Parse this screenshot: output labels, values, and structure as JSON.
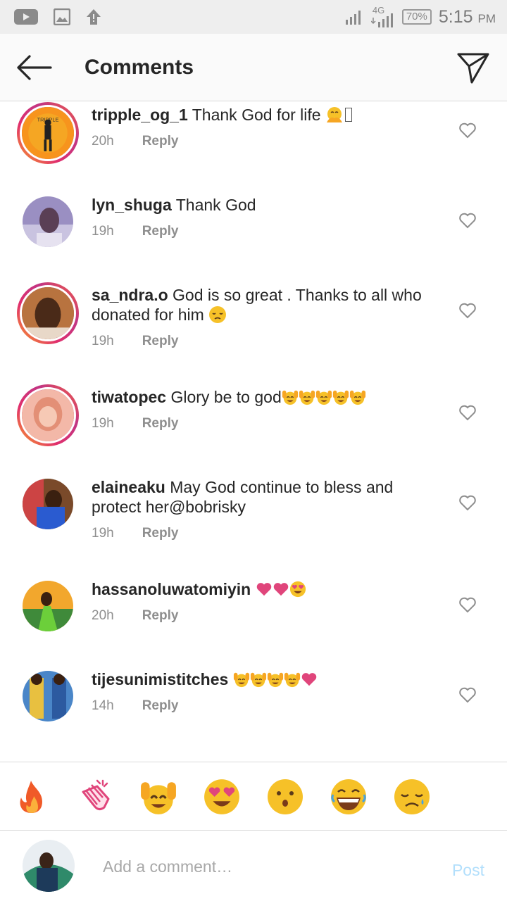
{
  "status_bar": {
    "network": "4G",
    "battery": "70%",
    "time": "5:15",
    "ampm": "PM"
  },
  "header": {
    "title": "Comments"
  },
  "comments": [
    {
      "user": "tripple_og_1",
      "text": "Thank God for life",
      "emojis": [
        "pray"
      ],
      "time": "20h",
      "reply": "Reply",
      "story_ring": true
    },
    {
      "user": "lyn_shuga",
      "text": "Thank God",
      "emojis": [],
      "time": "19h",
      "reply": "Reply",
      "story_ring": false
    },
    {
      "user": "sa_ndra.o",
      "text": "God is so great . Thanks to all who",
      "text_line2": "donated for him",
      "emojis": [
        "sad"
      ],
      "time": "19h",
      "reply": "Reply",
      "story_ring": true
    },
    {
      "user": "tiwatopec",
      "text": "Glory be to god",
      "emojis": [
        "raised-hands",
        "raised-hands",
        "raised-hands",
        "raised-hands",
        "raised-hands"
      ],
      "time": "19h",
      "reply": "Reply",
      "story_ring": true
    },
    {
      "user": "elaineaku",
      "text": "May God continue to bless and",
      "text_line2": "protect her@bobrisky",
      "emojis": [],
      "time": "19h",
      "reply": "Reply",
      "story_ring": false
    },
    {
      "user": "hassanoluwatomiyin",
      "text": "",
      "emojis": [
        "heart",
        "heart",
        "heart-eyes"
      ],
      "time": "20h",
      "reply": "Reply",
      "story_ring": false
    },
    {
      "user": "tijesunimistitches",
      "text": "",
      "emojis": [
        "raised-hands",
        "raised-hands",
        "raised-hands",
        "raised-hands",
        "heart"
      ],
      "time": "14h",
      "reply": "Reply",
      "story_ring": false
    }
  ],
  "emoji_bar": [
    "fire-icon",
    "clapping-hands-icon",
    "raised-hands-icon",
    "heart-eyes-icon",
    "surprised-icon",
    "laughing-icon",
    "sad-icon"
  ],
  "add_comment": {
    "placeholder": "Add a comment…",
    "post_label": "Post"
  },
  "colors": {
    "accent_post": "#b2dffc",
    "heart_emoji": "#e0457b",
    "emoji_yellow": "#f6c128"
  }
}
